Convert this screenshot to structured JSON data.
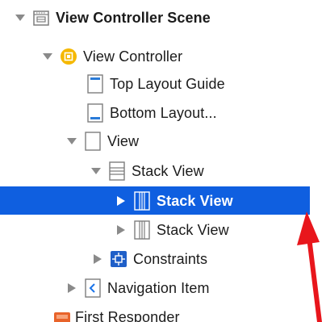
{
  "outline": {
    "scene": {
      "label": "View Controller Scene",
      "icon": "scene-icon",
      "expanded": true
    },
    "view_controller": {
      "label": "View Controller",
      "icon": "view-controller-icon",
      "expanded": true
    },
    "top_layout_guide": {
      "label": "Top Layout Guide",
      "icon": "top-layout-guide-icon"
    },
    "bottom_layout_guide": {
      "label": "Bottom Layout...",
      "icon": "bottom-layout-guide-icon"
    },
    "view": {
      "label": "View",
      "icon": "view-icon",
      "expanded": true
    },
    "stack_view_vertical": {
      "label": "Stack View",
      "icon": "vertical-stack-view-icon",
      "expanded": true
    },
    "stack_view_selected": {
      "label": "Stack View",
      "icon": "horizontal-stack-view-icon",
      "expanded": false,
      "selected": true
    },
    "stack_view_second": {
      "label": "Stack View",
      "icon": "horizontal-stack-view-icon",
      "expanded": false
    },
    "constraints": {
      "label": "Constraints",
      "icon": "constraints-icon",
      "expanded": false
    },
    "navigation_item": {
      "label": "Navigation Item",
      "icon": "navigation-item-icon",
      "expanded": false
    },
    "first_responder": {
      "label": "First Responder",
      "icon": "first-responder-icon"
    }
  },
  "colors": {
    "selection": "#0f5fe0",
    "disclosure": "#8a8a8a",
    "icon_outline": "#7d7d7d",
    "view_controller_icon": "#f5b800",
    "constraints_icon": "#1f5fc8",
    "navigation_icon": "#1a73e8",
    "first_responder_icon": "#e8632a",
    "annotation_arrow": "#e8161c"
  },
  "annotation": {
    "icon": "red-arrow-icon"
  }
}
